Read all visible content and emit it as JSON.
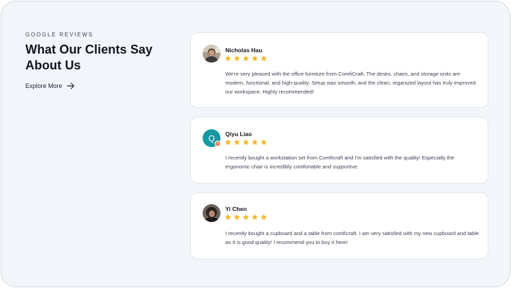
{
  "section": {
    "eyebrow": "GOOGLE REVIEWS",
    "heading_line1": "What Our Clients Say",
    "heading_line2": "About Us",
    "explore_label": "Explore More",
    "explore_icon": "arrow-right-icon"
  },
  "colors": {
    "page_bg": "#f2f5fa",
    "card_bg": "#ffffff",
    "star": "#f7b928",
    "accent_teal": "#1499a3"
  },
  "reviews": [
    {
      "name": "Nicholas Hau",
      "rating": 5,
      "avatar": "photo",
      "text": "We're very pleased with the office furniture from ComfiCraft. The desks, chairs, and storage units are modern, functional, and high-quality. Setup was smooth, and the clean, organized layout has truly improved our workspace. Highly recommended!"
    },
    {
      "name": "Qiyu Liao",
      "rating": 5,
      "avatar": "initial",
      "initial": "Q",
      "text": "I recently bought a workstation set from Comficraft and I'm satisfied with the quality! Especially the ergonomic chair is incredibly comfortable and supportive."
    },
    {
      "name": "Yi Chen",
      "rating": 5,
      "avatar": "photo",
      "text": "I recently bought a cupboard and a table from comficraft. I am very satisfied with my new cupboard and table as It is good quality! I recommend you to buy it here!"
    }
  ]
}
